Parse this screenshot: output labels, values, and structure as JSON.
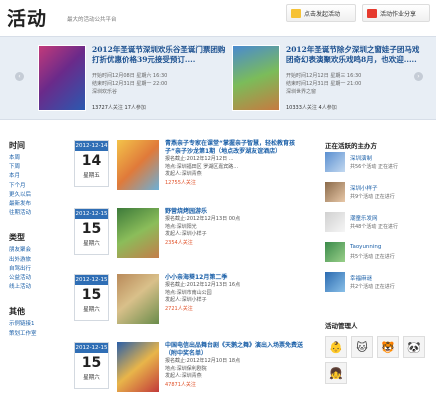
{
  "header": {
    "title": "活动",
    "slogan": "最大的活动公共平台",
    "btn_publish": "点击发起活动",
    "btn_share": "活动作业分享"
  },
  "carousel": {
    "cards": [
      {
        "title": "2012年圣诞节深圳欢乐谷圣诞门票团购打折优惠价格39元接受预订....",
        "start": "开始时间12月08日 星期六 16:30",
        "end": "结束时间12月31日 星期一 22:00",
        "place": "深圳欢乐谷",
        "followers": "13727",
        "followers_label": "人关注",
        "joined": "17",
        "joined_label": "人参加"
      },
      {
        "title": "2012年圣诞节除夕深圳之窗娃子团马戏团奇幻表演聚欢乐戏鸣8月，也欢迎.....",
        "start": "开始时间12月12日 星期三 16:30",
        "end": "结束时间12月31日 星期一 21:00",
        "place": "深圳世界之窗",
        "followers": "10333",
        "followers_label": "人关注",
        "joined": "4",
        "joined_label": "人参加"
      }
    ]
  },
  "sidebar": {
    "time_heading": "时间",
    "time_links": [
      "本周",
      "下周",
      "本月",
      "下个月",
      "更久以后",
      "最新发布",
      "往期活动"
    ],
    "type_heading": "类型",
    "type_links": [
      "朋友聚会",
      "出外游旅",
      "自驾出行",
      "公益活动",
      "线上活动"
    ],
    "other_heading": "其他",
    "other_links": [
      "示例链接1",
      "策划工作室"
    ]
  },
  "events": [
    {
      "date": "2012-12-14",
      "day": "14",
      "weekday": "星期五",
      "title": "青燕亲子专家在课堂“掌握亲子智慧，轻松教育孩子”亲子沙龙第1期（地点改罗湖友谊酒店）",
      "line1": "报名截止:2012年12月12日 ...",
      "line2": "地点:深圳福田区 罗湖区嘉宾路...",
      "line3": "发起人:深圳青燕",
      "follow": "12755人关注"
    },
    {
      "date": "2012-12-15",
      "day": "15",
      "weekday": "星期六",
      "title": "野营烧烤园游乐",
      "line1": "报名截止:2012年12月13日 00点",
      "line2": "地点:深圳阳光",
      "line3": "发起人:深圳小样子",
      "follow": "2354人关注"
    },
    {
      "date": "2012-12-15",
      "day": "15",
      "weekday": "星期六",
      "title": "小小亲海葵12月第二季",
      "line1": "报名截止:2012年12月13日 16点",
      "line2": "地点:深圳市南山公园",
      "line3": "发起人:深圳小样子",
      "follow": "2721人关注"
    },
    {
      "date": "2012-12-15",
      "day": "15",
      "weekday": "星期六",
      "title": "中国电信出品舞台剧《天鹅之舞》演出入场票免费送（附中奖名单）",
      "line1": "报名截止:2012年12月10日 18点",
      "line2": "地点:深圳保利剧院",
      "line3": "发起人:深圳青燕",
      "follow": "47871人关注"
    }
  ],
  "organizers": {
    "heading": "正在活跃的主办方",
    "items": [
      {
        "name": "深圳演制",
        "stat": "共56个活动 正在进行"
      },
      {
        "name": "深圳小样子",
        "stat": "共9个活动 正在进行"
      },
      {
        "name": "潮童乐发网",
        "stat": "共48个活动 正在进行"
      },
      {
        "name": "Taoyunning",
        "stat": "共5个活动 正在进行"
      },
      {
        "name": "幸福麻谜",
        "stat": "共2个活动 正在进行"
      }
    ]
  },
  "admins": {
    "heading": "活动管理人"
  },
  "colors": {
    "accent_blue": "#2f6eb5",
    "link_blue": "#1a5fa8",
    "follow_orange": "#e0522a"
  }
}
